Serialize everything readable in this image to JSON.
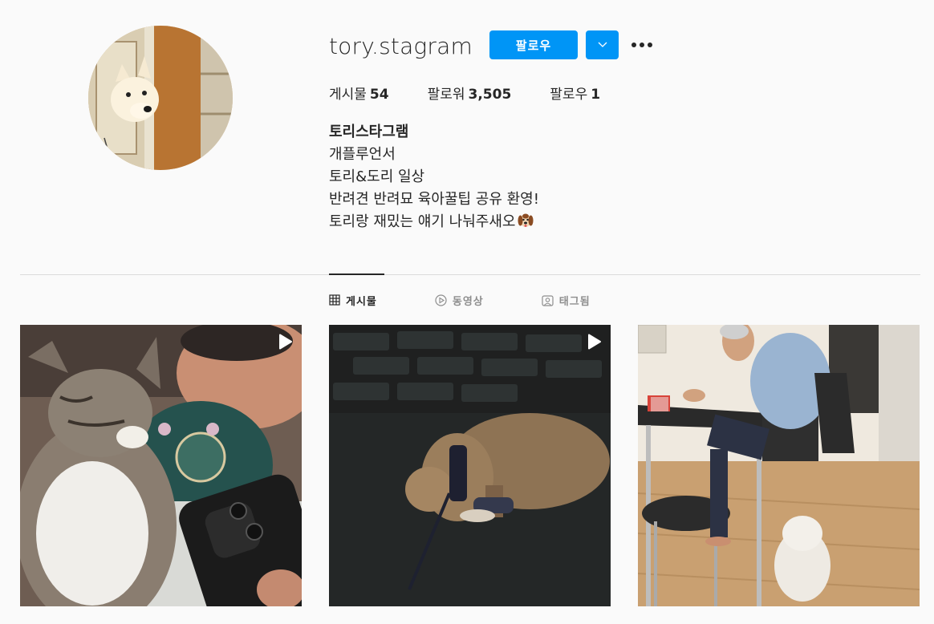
{
  "profile": {
    "username": "tory.stagram",
    "follow_label": "팔로우",
    "dropdown_icon": "chevron-down-icon",
    "more_icon": "more-options-icon",
    "stats": [
      {
        "label": "게시물",
        "value": "54"
      },
      {
        "label": "팔로워",
        "value": "3,505"
      },
      {
        "label": "팔로우",
        "value": "1"
      }
    ],
    "bio": {
      "name": "토리스타그램",
      "lines": [
        "개플루언서",
        "토리&도리 일상",
        "반려견 반려묘 육아꿀팁 공유 환영!",
        "토리랑 재밌는 얘기 나눠주새오"
      ],
      "trailing_emoji": "dog-face-emoji"
    }
  },
  "tabs": [
    {
      "label": "게시물",
      "icon": "grid-icon",
      "active": true
    },
    {
      "label": "동영상",
      "icon": "play-circle-icon",
      "active": false
    },
    {
      "label": "태그됨",
      "icon": "tagged-icon",
      "active": false
    }
  ],
  "posts": [
    {
      "subject": "cat-and-man-with-phone",
      "is_video": true
    },
    {
      "subject": "dog-at-night",
      "is_video": true
    },
    {
      "subject": "man-at-table-with-dog",
      "is_video": false
    }
  ],
  "colors": {
    "accent": "#0095f6",
    "text": "#262626",
    "muted": "#8e8e8e",
    "background": "#fafafa",
    "divider": "#dbdbdb"
  }
}
